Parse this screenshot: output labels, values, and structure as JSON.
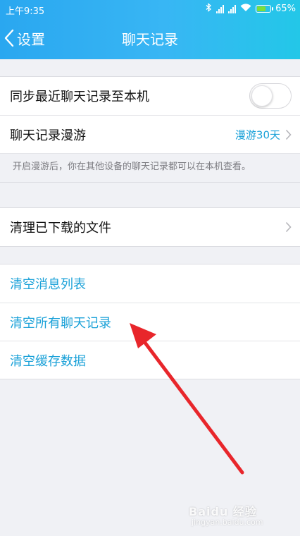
{
  "status_bar": {
    "time": "上午9:35",
    "battery_percent": "65%",
    "battery_level": 0.65
  },
  "nav": {
    "back_label": "设置",
    "title": "聊天记录"
  },
  "settings": {
    "sync_label": "同步最近聊天记录至本机",
    "sync_enabled": false,
    "roam_label": "聊天记录漫游",
    "roam_value": "漫游30天",
    "roam_hint": "开启漫游后，你在其他设备的聊天记录都可以在本机查看。",
    "clear_downloads_label": "清理已下载的文件"
  },
  "actions": {
    "clear_message_list": "清空消息列表",
    "clear_all_chat": "清空所有聊天记录",
    "clear_cache": "清空缓存数据"
  },
  "watermark": {
    "text": "Baidu 经验",
    "sub": "jingyan.baidu.com"
  },
  "colors": {
    "header_start": "#2aa7f0",
    "header_end": "#23c7e8",
    "link_blue": "#1aa1d8",
    "arrow_red": "#e8262b"
  }
}
